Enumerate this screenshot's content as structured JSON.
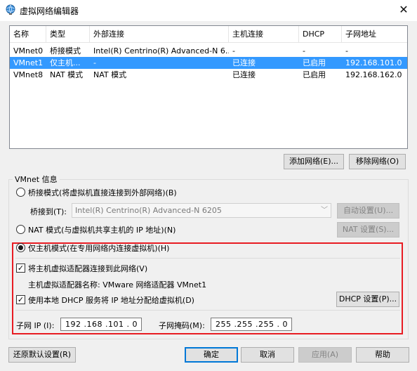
{
  "window": {
    "title": "虚拟网络编辑器",
    "close_glyph": "✕"
  },
  "table": {
    "columns": [
      "名称",
      "类型",
      "外部连接",
      "主机连接",
      "DHCP",
      "子网地址"
    ],
    "rows": [
      [
        "VMnet0",
        "桥接模式",
        "Intel(R) Centrino(R) Advanced-N 6...",
        "-",
        "-",
        "-"
      ],
      [
        "VMnet1",
        "仅主机...",
        "-",
        "已连接",
        "已启用",
        "192.168.101.0"
      ],
      [
        "VMnet8",
        "NAT 模式",
        "NAT 模式",
        "已连接",
        "已启用",
        "192.168.162.0"
      ]
    ],
    "selected_row": 1
  },
  "buttons": {
    "add_network": "添加网络(E)...",
    "remove_network": "移除网络(O)",
    "auto_settings": "自动设置(U)...",
    "nat_settings": "NAT 设置(S)...",
    "dhcp_settings": "DHCP 设置(P)...",
    "restore_defaults": "还原默认设置(R)",
    "ok": "确定",
    "cancel": "取消",
    "apply": "应用(A)",
    "help": "帮助"
  },
  "vmnet_info": {
    "group_title": "VMnet 信息",
    "bridged_label": "桥接模式(将虚拟机直接连接到外部网络)(B)",
    "bridged_to_label": "桥接到(T):",
    "bridged_to_value": "Intel(R) Centrino(R) Advanced-N 6205",
    "nat_label": "NAT 模式(与虚拟机共享主机的 IP 地址)(N)",
    "hostonly_label": "仅主机模式(在专用网络内连接虚拟机)(H)",
    "connect_adapter_label": "将主机虚拟适配器连接到此网络(V)",
    "adapter_name_label": "主机虚拟适配器名称: VMware 网络适配器 VMnet1",
    "use_dhcp_label": "使用本地 DHCP 服务将 IP 地址分配给虚拟机(D)",
    "subnet_ip_label": "子网 IP (I):",
    "subnet_ip_value": "192 .168 .101 . 0",
    "subnet_mask_label": "子网掩码(M):",
    "subnet_mask_value": "255 .255 .255 . 0",
    "selected_mode": "hostonly",
    "connect_adapter_checked": true,
    "use_dhcp_checked": true
  },
  "colors": {
    "selection": "#3399ff",
    "highlight_box": "#e81c23",
    "default_button_border": "#0078d7"
  }
}
